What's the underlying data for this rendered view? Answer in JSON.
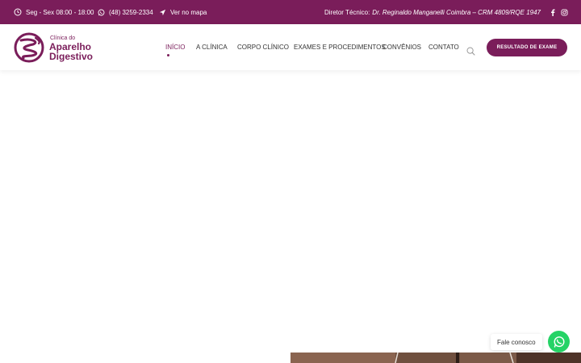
{
  "topbar": {
    "hours": "Seg - Sex 08:00 - 18:00",
    "phone": "(48) 3259-2334",
    "map_link": "Ver no mapa",
    "director_label": "Diretor Técnico:",
    "director_name": "Dr. Reginaldo Manganelli Coimbra – CRM 4809/RQE 1947",
    "social": [
      "facebook-icon",
      "instagram-icon"
    ]
  },
  "logo": {
    "line1": "Clínica do",
    "line2": "Aparelho",
    "line3": "Digestivo"
  },
  "nav": {
    "items": [
      {
        "label": "INÍCIO",
        "active": true
      },
      {
        "label": "A CLÍNICA"
      },
      {
        "label": "CORPO CLÍNICO"
      },
      {
        "label": "EXAMES E PROCEDIMENTOS"
      },
      {
        "label": "CONVÊNIOS"
      },
      {
        "label": "CONTATO"
      }
    ],
    "search_icon": "search-icon",
    "cta_label": "RESULTADO DE EXAME"
  },
  "chat": {
    "label": "Fale conosco",
    "icon": "whatsapp-icon"
  },
  "colors": {
    "brand": "#7a1d5a",
    "whatsapp": "#25d366",
    "text": "#333333"
  }
}
